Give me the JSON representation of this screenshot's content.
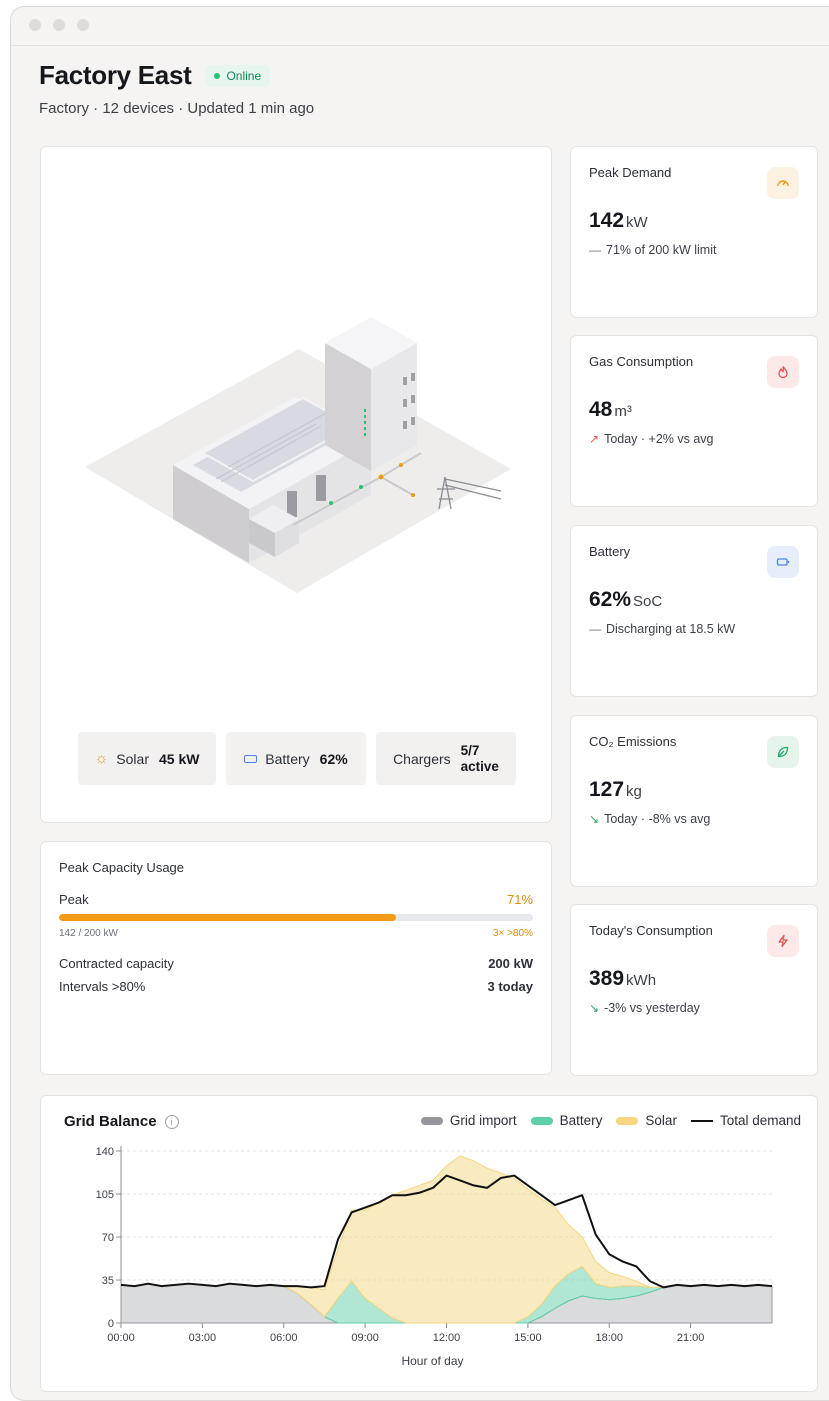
{
  "header": {
    "title": "Factory East",
    "status": "Online",
    "subtitle": "Factory · 12 devices · Updated 1 min ago"
  },
  "site_chips": [
    {
      "label": "Solar",
      "value": "45 kW",
      "icon": "sun-icon"
    },
    {
      "label": "Battery",
      "value": "62%",
      "icon": "battery-icon"
    },
    {
      "label": "Chargers",
      "value_line1": "5/7",
      "value_line2": "active"
    }
  ],
  "kpis": [
    {
      "title": "Peak Demand",
      "value": "142",
      "unit": "kW",
      "mark": "—",
      "note": "71% of 200 kW limit",
      "icon": "gauge-icon",
      "icon_color": "#f29a16",
      "icon_bg": "#fdf1e2",
      "mark_color": "#6b7079"
    },
    {
      "title": "Gas Consumption",
      "value": "48",
      "unit": "m³",
      "mark": "↗",
      "note": "Today · +2% vs avg",
      "icon": "flame-icon",
      "icon_color": "#e8514f",
      "icon_bg": "#fde9e8",
      "mark_color": "#e8514f"
    },
    {
      "title": "Battery",
      "value": "62%",
      "unit": "SoC",
      "mark": "—",
      "note": "Discharging at 18.5 kW",
      "icon": "battery-icon",
      "icon_color": "#4a84e8",
      "icon_bg": "#e6eefc",
      "mark_color": "#6b7079"
    },
    {
      "title": "CO₂ Emissions",
      "value": "127",
      "unit": "kg",
      "mark": "↘",
      "note": "Today · -8% vs avg",
      "icon": "leaf-icon",
      "icon_color": "#27a86a",
      "icon_bg": "#e5f5ec",
      "mark_color": "#27a86a"
    },
    {
      "title": "Today's Consumption",
      "value": "389",
      "unit": "kWh",
      "mark": "↘",
      "note": "-3% vs yesterday",
      "icon": "bolt-icon",
      "icon_color": "#e8514f",
      "icon_bg": "#fde9e8",
      "mark_color": "#27a86a"
    }
  ],
  "capacity": {
    "title": "Peak Capacity Usage",
    "peak_label": "Peak",
    "peak_percent_text": "71%",
    "peak_fraction": 0.71,
    "usage_text": "142 / 200 kW",
    "intervals_badge": "3× >80%",
    "contracted_label": "Contracted capacity",
    "contracted_value": "200 kW",
    "intervals_label": "Intervals >80%",
    "intervals_value": "3 today"
  },
  "grid_balance": {
    "title": "Grid Balance",
    "legend": [
      "Grid import",
      "Battery",
      "Solar",
      "Total demand"
    ]
  },
  "chart_data": {
    "type": "area",
    "xlabel": "Hour of day",
    "ylabel": "",
    "x_ticks": [
      "00:00",
      "03:00",
      "06:00",
      "09:00",
      "12:00",
      "15:00",
      "18:00",
      "21:00"
    ],
    "y_ticks": [
      0,
      35,
      70,
      105,
      140
    ],
    "xlim": [
      0,
      24
    ],
    "ylim": [
      0,
      140
    ],
    "grid": true,
    "legend_position": "top-right",
    "x": [
      0,
      0.5,
      1,
      1.5,
      2,
      2.5,
      3,
      3.5,
      4,
      4.5,
      5,
      5.5,
      6,
      6.5,
      7,
      7.5,
      8,
      8.5,
      9,
      9.5,
      10,
      10.5,
      11,
      11.5,
      12,
      12.5,
      13,
      13.5,
      14,
      14.5,
      15,
      15.5,
      16,
      16.5,
      17,
      17.5,
      18,
      18.5,
      19,
      19.5,
      20,
      20.5,
      21,
      21.5,
      22,
      22.5,
      23,
      23.5,
      24
    ],
    "series": [
      {
        "name": "Grid import",
        "color": "#94979c",
        "values": [
          31,
          30,
          32,
          30,
          31,
          32,
          31,
          30,
          32,
          31,
          30,
          31,
          30,
          24,
          15,
          5,
          0,
          0,
          0,
          0,
          0,
          0,
          0,
          0,
          0,
          0,
          0,
          0,
          0,
          0,
          0,
          5,
          12,
          18,
          22,
          20,
          19,
          20,
          22,
          25,
          29,
          31,
          30,
          31,
          30,
          31,
          30,
          31,
          30
        ]
      },
      {
        "name": "Battery",
        "color": "#5fcfa9",
        "values": [
          0,
          0,
          0,
          0,
          0,
          0,
          0,
          0,
          0,
          0,
          0,
          0,
          0,
          0,
          0,
          0,
          20,
          34,
          20,
          12,
          4,
          0,
          0,
          0,
          0,
          0,
          0,
          0,
          0,
          0,
          5,
          10,
          18,
          22,
          24,
          12,
          10,
          10,
          8,
          4,
          0,
          0,
          0,
          0,
          0,
          0,
          0,
          0,
          0
        ]
      },
      {
        "name": "Solar",
        "color": "#f6d680",
        "values": [
          0,
          0,
          0,
          0,
          0,
          0,
          0,
          0,
          0,
          0,
          0,
          0,
          0,
          6,
          14,
          22,
          40,
          58,
          72,
          86,
          100,
          108,
          112,
          116,
          128,
          136,
          132,
          126,
          122,
          118,
          104,
          86,
          64,
          40,
          24,
          18,
          12,
          8,
          4,
          0,
          0,
          0,
          0,
          0,
          0,
          0,
          0,
          0,
          0
        ]
      },
      {
        "name": "Total demand",
        "color": "#111111",
        "values": [
          31,
          30,
          32,
          30,
          31,
          32,
          31,
          30,
          32,
          31,
          30,
          31,
          30,
          30,
          29,
          30,
          68,
          90,
          94,
          98,
          104,
          104,
          106,
          110,
          120,
          116,
          112,
          110,
          118,
          120,
          112,
          104,
          96,
          100,
          104,
          72,
          56,
          50,
          46,
          34,
          29,
          31,
          30,
          31,
          30,
          31,
          30,
          31,
          30
        ]
      }
    ]
  }
}
